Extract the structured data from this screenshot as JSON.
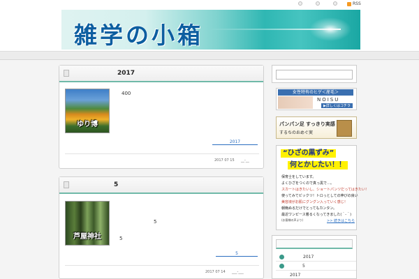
{
  "topnav": {
    "rss": "RSS"
  },
  "header": {
    "site_title": "雑学の小箱"
  },
  "posts": [
    {
      "title": "2017",
      "thumb_label": "ゆり博",
      "excerpt": "400",
      "more": "2017",
      "date": "2017 07 15",
      "cat": "__-__"
    },
    {
      "title": "5",
      "thumb_label": "芦屋神社",
      "excerpt_1": "5",
      "excerpt_2": "5",
      "more": "5",
      "date": "2017 07 14",
      "cat": "___-___"
    }
  ],
  "sidebar": {
    "ad1": {
      "line1": "女性特有のヒゲ＜産毛＞",
      "brand": "NOISU",
      "link": "▶詳しくはコチラ"
    },
    "ad2": {
      "line1": "パンパン足 すっきり実感",
      "line2": "するちのおめぐ実"
    },
    "ad3": {
      "headline1": "“ひざの黒ずみ”",
      "headline2": "何とかしたい！！",
      "body1": "保育士をしています。",
      "body2": "よくひざをつくので真っ黒で…。",
      "body3": "スカートはきたいし、ショートパンツだってはきたい！",
      "body4": "使ってみてビックリ！トロっとしての伸びの良い",
      "body5": "美容液がお肌にグングン入っていく感じ！",
      "body6": "朝晩ぬるだけでとってもカンタン。",
      "body7": "最近ワンピース着るくなってきました(＾-＾)",
      "body8": "(お客様の声より)",
      "link": ">> 続きはこちら"
    },
    "list": [
      "2017",
      "5",
      "2017"
    ]
  },
  "colors": {
    "accent": "#6fb9a8",
    "link": "#2a6ec0",
    "banner": "#2fb7b3"
  }
}
